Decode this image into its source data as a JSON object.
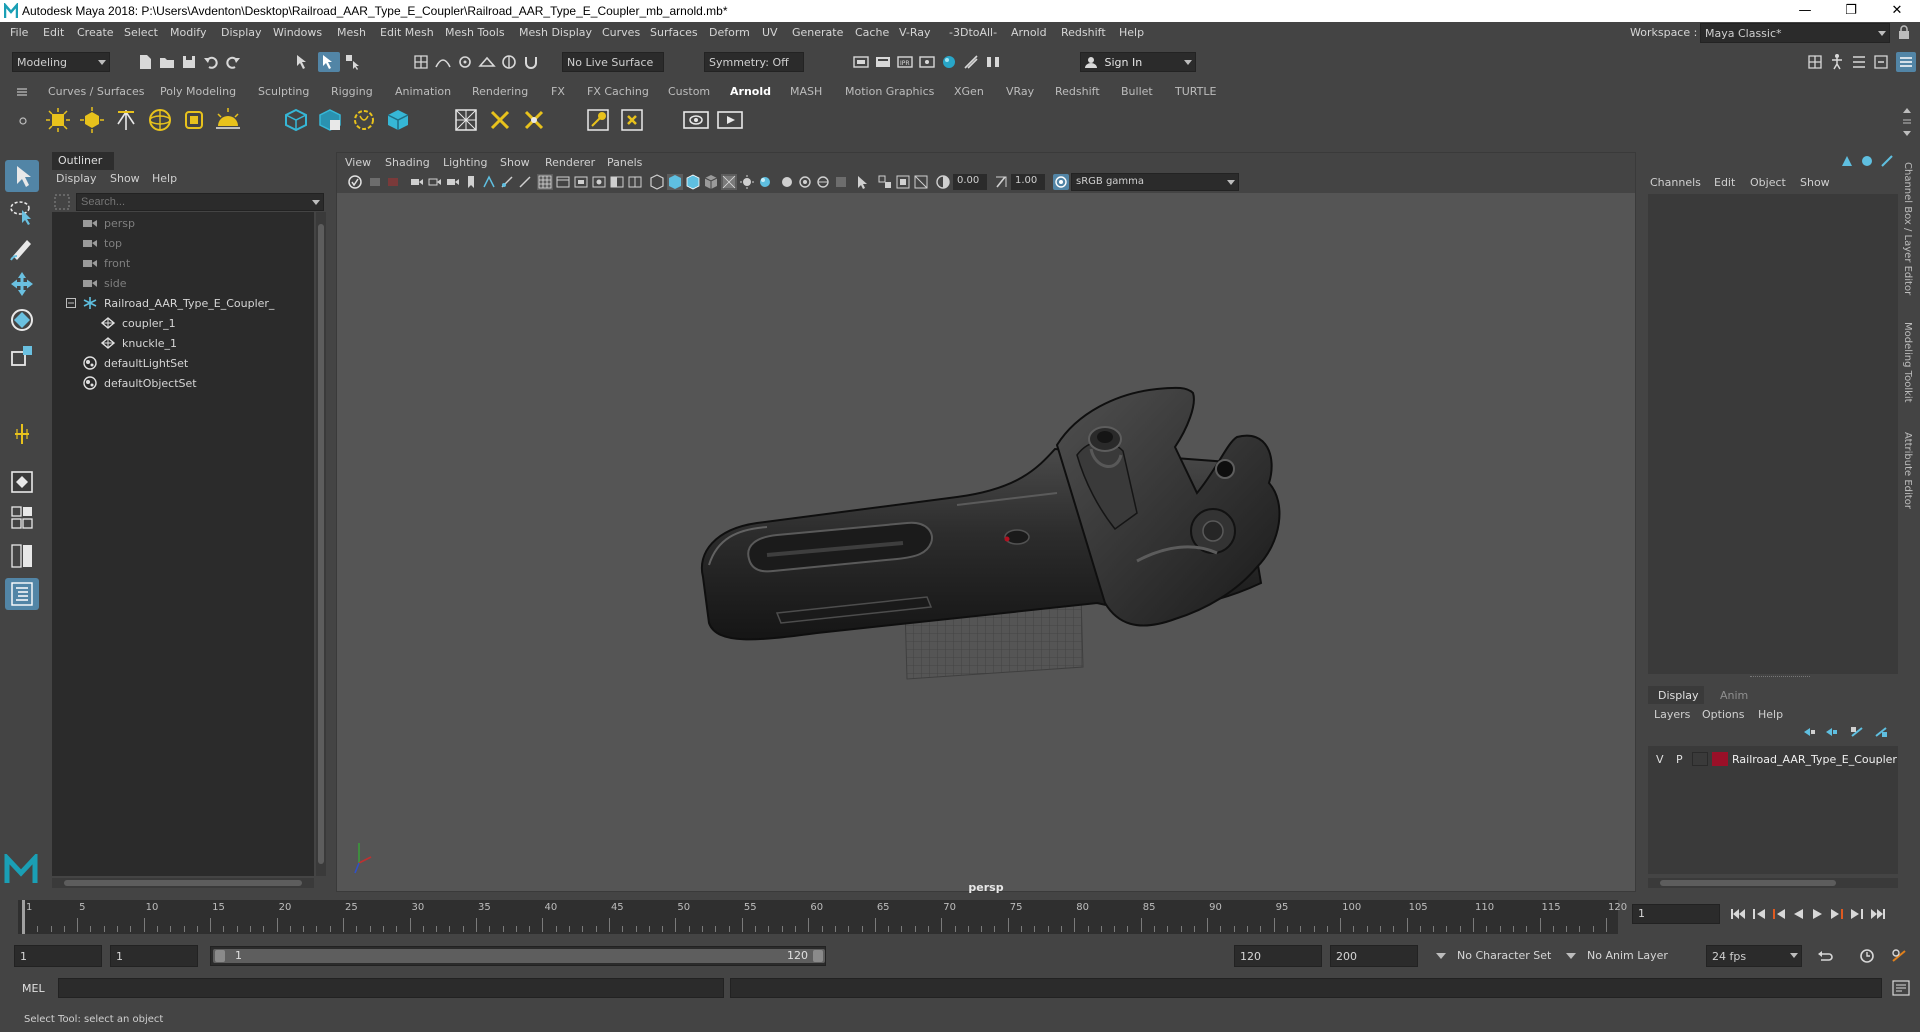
{
  "titlebar": {
    "title": "Autodesk Maya 2018: P:\\Users\\Avdenton\\Desktop\\Railroad_AAR_Type_E_Coupler\\Railroad_AAR_Type_E_Coupler_mb_arnold.mb*",
    "minimize": "—",
    "maximize": "❐",
    "close": "✕"
  },
  "menubar": {
    "items": [
      "File",
      "Edit",
      "Create",
      "Select",
      "Modify",
      "Display",
      "Windows",
      "Mesh",
      "Edit Mesh",
      "Mesh Tools",
      "Mesh Display",
      "Curves",
      "Surfaces",
      "Deform",
      "UV",
      "Generate",
      "Cache",
      "V-Ray",
      "-3DtoAll-",
      "Arnold",
      "Redshift",
      "Help"
    ],
    "workspace_label": "Workspace :",
    "workspace_value": "Maya Classic*"
  },
  "statusline": {
    "mode": "Modeling",
    "live_surface": "No Live Surface",
    "symmetry": "Symmetry: Off",
    "sign_in": "Sign In"
  },
  "shelf": {
    "tabs": [
      "Curves / Surfaces",
      "Poly Modeling",
      "Sculpting",
      "Rigging",
      "Animation",
      "Rendering",
      "FX",
      "FX Caching",
      "Custom",
      "Arnold",
      "MASH",
      "Motion Graphics",
      "XGen",
      "VRay",
      "Redshift",
      "Bullet",
      "TURTLE"
    ],
    "active_tab": "Arnold"
  },
  "outliner": {
    "tab": "Outliner",
    "menu": [
      "Display",
      "Show",
      "Help"
    ],
    "search_placeholder": "Search...",
    "nodes": [
      {
        "label": "persp",
        "dim": true,
        "indent": 0,
        "icon": "camera-icon"
      },
      {
        "label": "top",
        "dim": true,
        "indent": 0,
        "icon": "camera-icon"
      },
      {
        "label": "front",
        "dim": true,
        "indent": 0,
        "icon": "camera-icon"
      },
      {
        "label": "side",
        "dim": true,
        "indent": 0,
        "icon": "camera-icon"
      },
      {
        "label": "Railroad_AAR_Type_E_Coupler_",
        "dim": false,
        "indent": 0,
        "icon": "group-icon"
      },
      {
        "label": "coupler_1",
        "dim": false,
        "indent": 1,
        "icon": "mesh-icon"
      },
      {
        "label": "knuckle_1",
        "dim": false,
        "indent": 1,
        "icon": "mesh-icon"
      },
      {
        "label": "defaultLightSet",
        "dim": false,
        "indent": 0,
        "icon": "set-icon"
      },
      {
        "label": "defaultObjectSet",
        "dim": false,
        "indent": 0,
        "icon": "set-icon"
      }
    ]
  },
  "viewport": {
    "menu": [
      "View",
      "Shading",
      "Lighting",
      "Show",
      "Renderer",
      "Panels"
    ],
    "exposure": "0.00",
    "gamma": "1.00",
    "color_space": "sRGB gamma",
    "camera": "persp"
  },
  "channelbox": {
    "menu": [
      "Channels",
      "Edit",
      "Object",
      "Show"
    ],
    "side_tabs": [
      "Channel Box / Layer Editor",
      "Modeling Toolkit",
      "Attribute Editor"
    ]
  },
  "layereditor": {
    "tabs": [
      "Display",
      "Anim"
    ],
    "menu": [
      "Layers",
      "Options",
      "Help"
    ],
    "layer": {
      "v": "V",
      "p": "P",
      "name": "Railroad_AAR_Type_E_Coupler",
      "color": "#9a1028"
    }
  },
  "timeslider": {
    "ticks": [
      "1",
      "5",
      "10",
      "15",
      "20",
      "25",
      "30",
      "35",
      "40",
      "45",
      "50",
      "55",
      "60",
      "65",
      "70",
      "75",
      "80",
      "85",
      "90",
      "95",
      "100",
      "105",
      "110",
      "115",
      "120"
    ],
    "current_frame": "1"
  },
  "rangeslider": {
    "start": "1",
    "playback_start": "1",
    "range_start": "1",
    "range_end": "120",
    "playback_end": "120",
    "end": "200",
    "character_set": "No Character Set",
    "anim_layer": "No Anim Layer",
    "fps": "24 fps"
  },
  "commandline": {
    "lang": "MEL"
  },
  "helpline": {
    "text": "Select Tool: select an object"
  },
  "colors": {
    "accent": "#5285a6",
    "panel": "#444444",
    "field": "#2b2b2b",
    "viewport": "#555555"
  }
}
